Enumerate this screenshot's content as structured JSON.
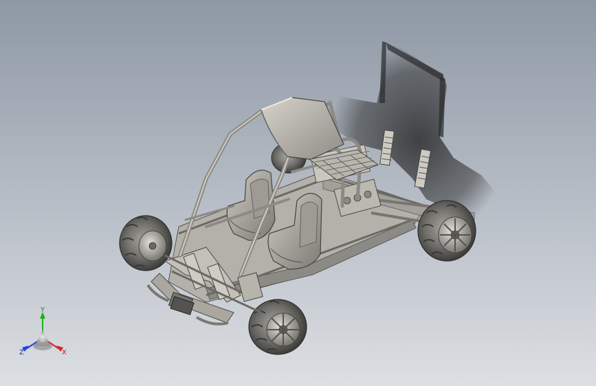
{
  "viewport": {
    "background_top": "#8e98a4",
    "background_bottom": "#dcdfe3"
  },
  "model": {
    "kind": "off-road buggy 3D model",
    "body_color": "#bdbab3",
    "tire_color": "#6f6e6a"
  },
  "triad": {
    "x_label": "X",
    "y_label": "Y",
    "z_label": "Z",
    "x_color": "#e02020",
    "y_color": "#20b020",
    "z_color": "#2040e0"
  }
}
